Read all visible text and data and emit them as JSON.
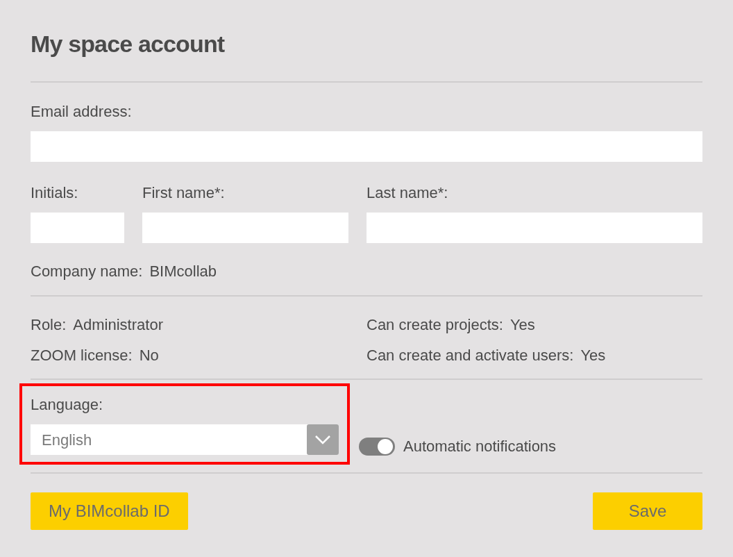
{
  "title": "My space account",
  "email": {
    "label": "Email address:"
  },
  "name_fields": [
    {
      "label": "Initials:"
    },
    {
      "label": "First name*:"
    },
    {
      "label": "Last name*:"
    }
  ],
  "company": {
    "label": "Company name:",
    "value": "BIMcollab"
  },
  "info": [
    {
      "label": "Role:",
      "value": "Administrator"
    },
    {
      "label": "Can create projects:",
      "value": "Yes"
    },
    {
      "label": "ZOOM license:",
      "value": "No"
    },
    {
      "label": "Can create and activate users:",
      "value": "Yes"
    }
  ],
  "language": {
    "label": "Language:",
    "value": "English",
    "highlighted": true
  },
  "notifications": {
    "label": "Automatic notifications",
    "on": true
  },
  "buttons": [
    {
      "label": "My BIMcollab ID"
    },
    {
      "label": "Save"
    }
  ]
}
